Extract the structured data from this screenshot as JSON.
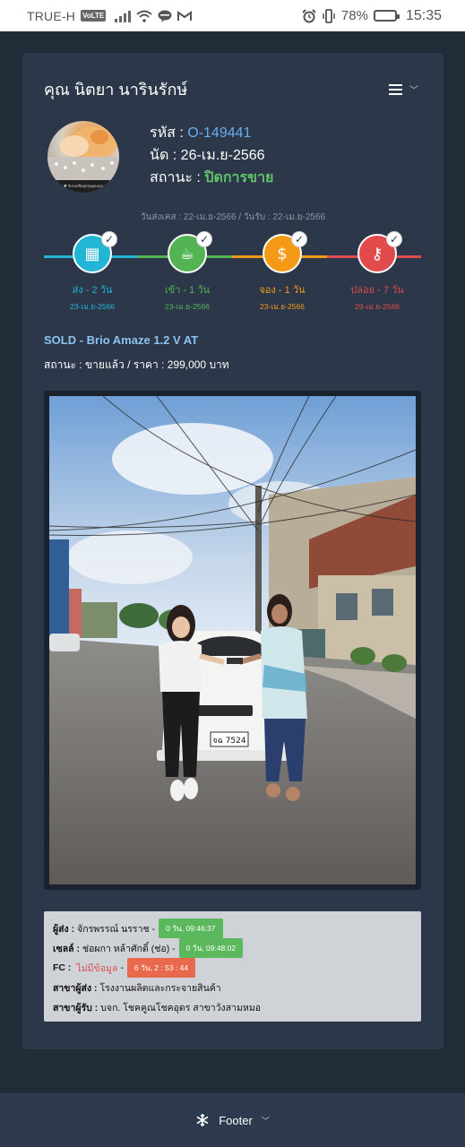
{
  "statusbar": {
    "carrier": "TRUE-H",
    "volte": "VoLTE",
    "battery_percent": "78%",
    "battery_level": 0.78,
    "time": "15:35",
    "icons": [
      "signal-icon",
      "wifi-icon",
      "line-app-icon",
      "gmail-icon",
      "alarm-icon",
      "vibrate-icon",
      "battery-icon"
    ]
  },
  "header": {
    "customer_name": "คุณ นิตยา นารินรักษ์",
    "menu_icon": "hamburger-icon"
  },
  "profile": {
    "code_label": "รหัส : ",
    "code_value": "O-149441",
    "appointment_label": "นัด : ",
    "appointment_value": "26-เม.ย-2566",
    "status_label": "สถานะ : ",
    "status_value": "ปิดการขาย",
    "avatar_caption": "♥ รับรถหรือทุกรุ่นทุกแบบ",
    "status_color": "#5fc26b",
    "code_color": "#67b0f0"
  },
  "dates_line": "วันส่งเคส : 22-เม.ย-2566 / วันรับ : 22-เม.ย-2566",
  "timeline": [
    {
      "label": "ส่ง - 2 วัน",
      "date": "23-เม.ย-2566",
      "color": "#22b5d6",
      "icon": "calculator-icon",
      "glyph": "▦"
    },
    {
      "label": "เข้า - 1 วัน",
      "date": "23-เม.ย-2566",
      "color": "#52b452",
      "icon": "coffee-icon",
      "glyph": "☕"
    },
    {
      "label": "จอง - 1 วัน",
      "date": "23-เม.ย-2566",
      "color": "#f59a17",
      "icon": "money-icon",
      "glyph": "$"
    },
    {
      "label": "ปล่อย - 7 วัน",
      "date": "29-เม.ย-2566",
      "color": "#e14b4b",
      "icon": "key-icon",
      "glyph": "⚷"
    }
  ],
  "sale": {
    "title": "SOLD - Brio Amaze 1.2 V AT",
    "subtitle": "สถานะ : ขายแล้ว / ราคา : 299,000 บาท"
  },
  "photo": {
    "plate_text": "จฉ 7524"
  },
  "details": {
    "sender_label": "ผู้ส่ง :",
    "sender_value": "จักรพรรณ์ นรราช -",
    "sender_badge": "0 วัน, 09:46:37",
    "sales_label": "เซลล์ :",
    "sales_value": "ช่อผกา หล้าศักดิ์ (ช่อ) -",
    "sales_badge": "0 วัน, 09:48:02",
    "fc_label": "FC :",
    "fc_value": "ไม่มีข้อมูล",
    "fc_dash": "-",
    "fc_badge": "6 วัน, 2 : 53 : 44",
    "branch_send_label": "สาขาผู้ส่ง :",
    "branch_send_value": "โรงงานผลิตและกระจายสินค้า",
    "branch_recv_label": "สาขาผู้รับ :",
    "branch_recv_value": "บจก. โชคคูณโชคอุดร สาขาวังสามหมอ"
  },
  "footer": {
    "label": "Footer",
    "icon": "snowflake-icon"
  }
}
